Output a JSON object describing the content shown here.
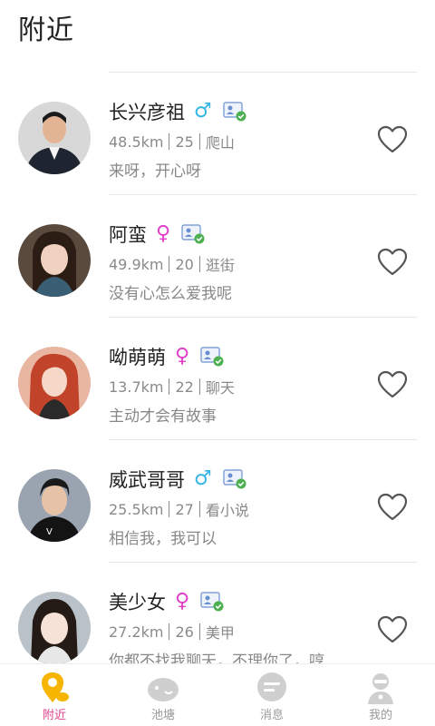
{
  "header": {
    "title": "附近"
  },
  "users": [
    {
      "name": "长兴彦祖",
      "gender": "male",
      "gender_symbol": "♂",
      "distance": "48.5km",
      "age": "25",
      "interest": "爬山",
      "bio": "来呀，开心呀"
    },
    {
      "name": "阿蛮",
      "gender": "female",
      "gender_symbol": "♀",
      "distance": "49.9km",
      "age": "20",
      "interest": "逛街",
      "bio": "没有心怎么爱我呢"
    },
    {
      "name": "呦萌萌",
      "gender": "female",
      "gender_symbol": "♀",
      "distance": "13.7km",
      "age": "22",
      "interest": "聊天",
      "bio": "主动才会有故事"
    },
    {
      "name": "威武哥哥",
      "gender": "male",
      "gender_symbol": "♂",
      "distance": "25.5km",
      "age": "27",
      "interest": "看小说",
      "bio": "相信我，我可以"
    },
    {
      "name": "美少女",
      "gender": "female",
      "gender_symbol": "♀",
      "distance": "27.2km",
      "age": "26",
      "interest": "美甲",
      "bio": "你都不找我聊天，不理你了，哼"
    }
  ],
  "tabs": [
    {
      "label": "附近",
      "active": true,
      "icon": "location-pin-icon"
    },
    {
      "label": "池塘",
      "active": false,
      "icon": "fish-icon"
    },
    {
      "label": "消息",
      "active": false,
      "icon": "chat-bubble-icon"
    },
    {
      "label": "我的",
      "active": false,
      "icon": "user-icon"
    }
  ],
  "colors": {
    "male": "#33b5e5",
    "female": "#e040c8",
    "active_tab": "#e0428a",
    "active_icon": "#f7b500",
    "verify_green": "#4caf50"
  }
}
